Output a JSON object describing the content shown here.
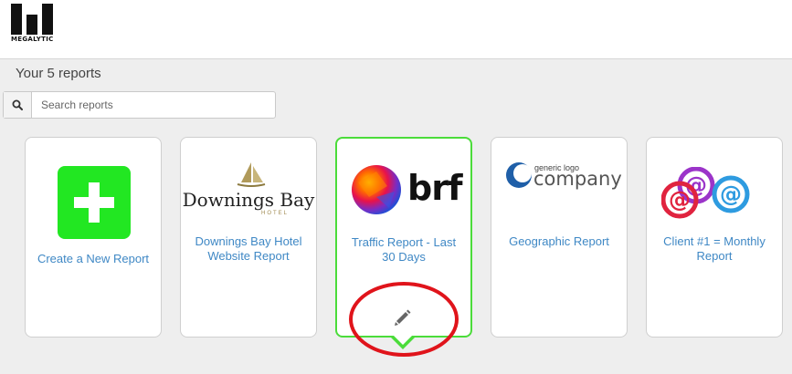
{
  "brand": {
    "name": "MEGALYTIC",
    "logo_icon": "bar-logo-icon",
    "color": "#111111"
  },
  "heading": "Your 5 reports",
  "search": {
    "placeholder": "Search reports",
    "value": "",
    "icon": "search-icon"
  },
  "reports": [
    {
      "title": "Create a New Report",
      "icon": "plus-icon",
      "accent": "#22e722"
    },
    {
      "title": "Downings Bay Hotel Website Report",
      "logo": {
        "line1": "Downings Bay",
        "line2": "HOTEL"
      }
    },
    {
      "title": "Traffic Report - Last 30 Days",
      "logo": {
        "text": "brf"
      },
      "selected": true,
      "edit_icon": "pencil-icon"
    },
    {
      "title": "Geographic Report",
      "logo": {
        "small": "generic logo",
        "big": "company"
      }
    },
    {
      "title": "Client #1 = Monthly Report",
      "logo": {
        "icon": "at-sign-icons"
      }
    }
  ],
  "colors": {
    "link": "#3f88c5",
    "selected_border": "#4bdc3a",
    "annotation_ring": "#e0141b"
  }
}
